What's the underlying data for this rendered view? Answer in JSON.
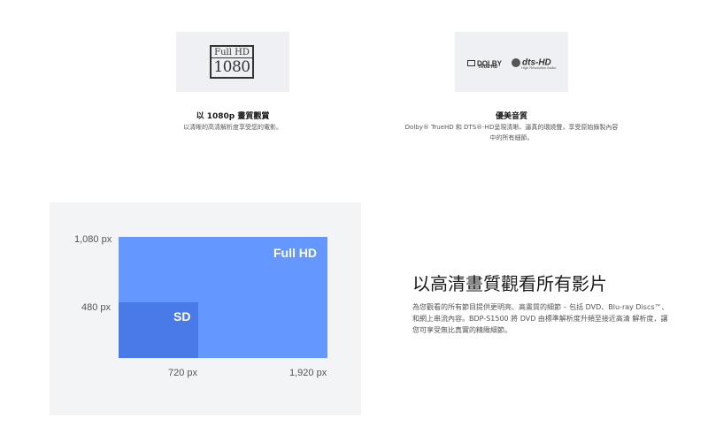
{
  "features": [
    {
      "image": {
        "line1": "Full HD",
        "line2": "1080",
        "icon": "full-hd-1080-logo"
      },
      "title": "以 1080p 畫質觀賞",
      "desc": "以清晰的高清解析度享受您的電影。"
    },
    {
      "image": {
        "dolby_name": "DOLBY",
        "dolby_sub": "TRUE HD",
        "dts_name": "dts-HD",
        "dts_sub": "High Resolution Audio",
        "icon": "dolby-dts-logo"
      },
      "title": "優美音質",
      "desc_line1": "Dolby® TrueHD 和 DTS®-HD呈現清晰、逼真的環繞聲，享受原始錄製內容",
      "desc_line2": "中的所有細節。"
    }
  ],
  "diagram": {
    "fullhd_label": "Full HD",
    "sd_label": "SD",
    "y_labels": {
      "top": "1,080 px",
      "mid": "480 px"
    },
    "x_labels": {
      "mid": "720 px",
      "right": "1,920 px"
    },
    "colors": {
      "fullhd": "#6497ff",
      "sd": "#4a7ae8",
      "panel": "#f3f4f6"
    }
  },
  "section": {
    "headline": "以高清畫質觀看所有影片",
    "body_line1": "為您觀看的所有節目提供更明亮、高畫質的細節 – 包括 DVD、Blu-ray Discs™、",
    "body_line2": "和網上串流內容。BDP-S1500 將 DVD 由標準解析度升頻至接近高清 解析度，讓",
    "body_line3": "您可享受無比真實的精緻細節。"
  }
}
